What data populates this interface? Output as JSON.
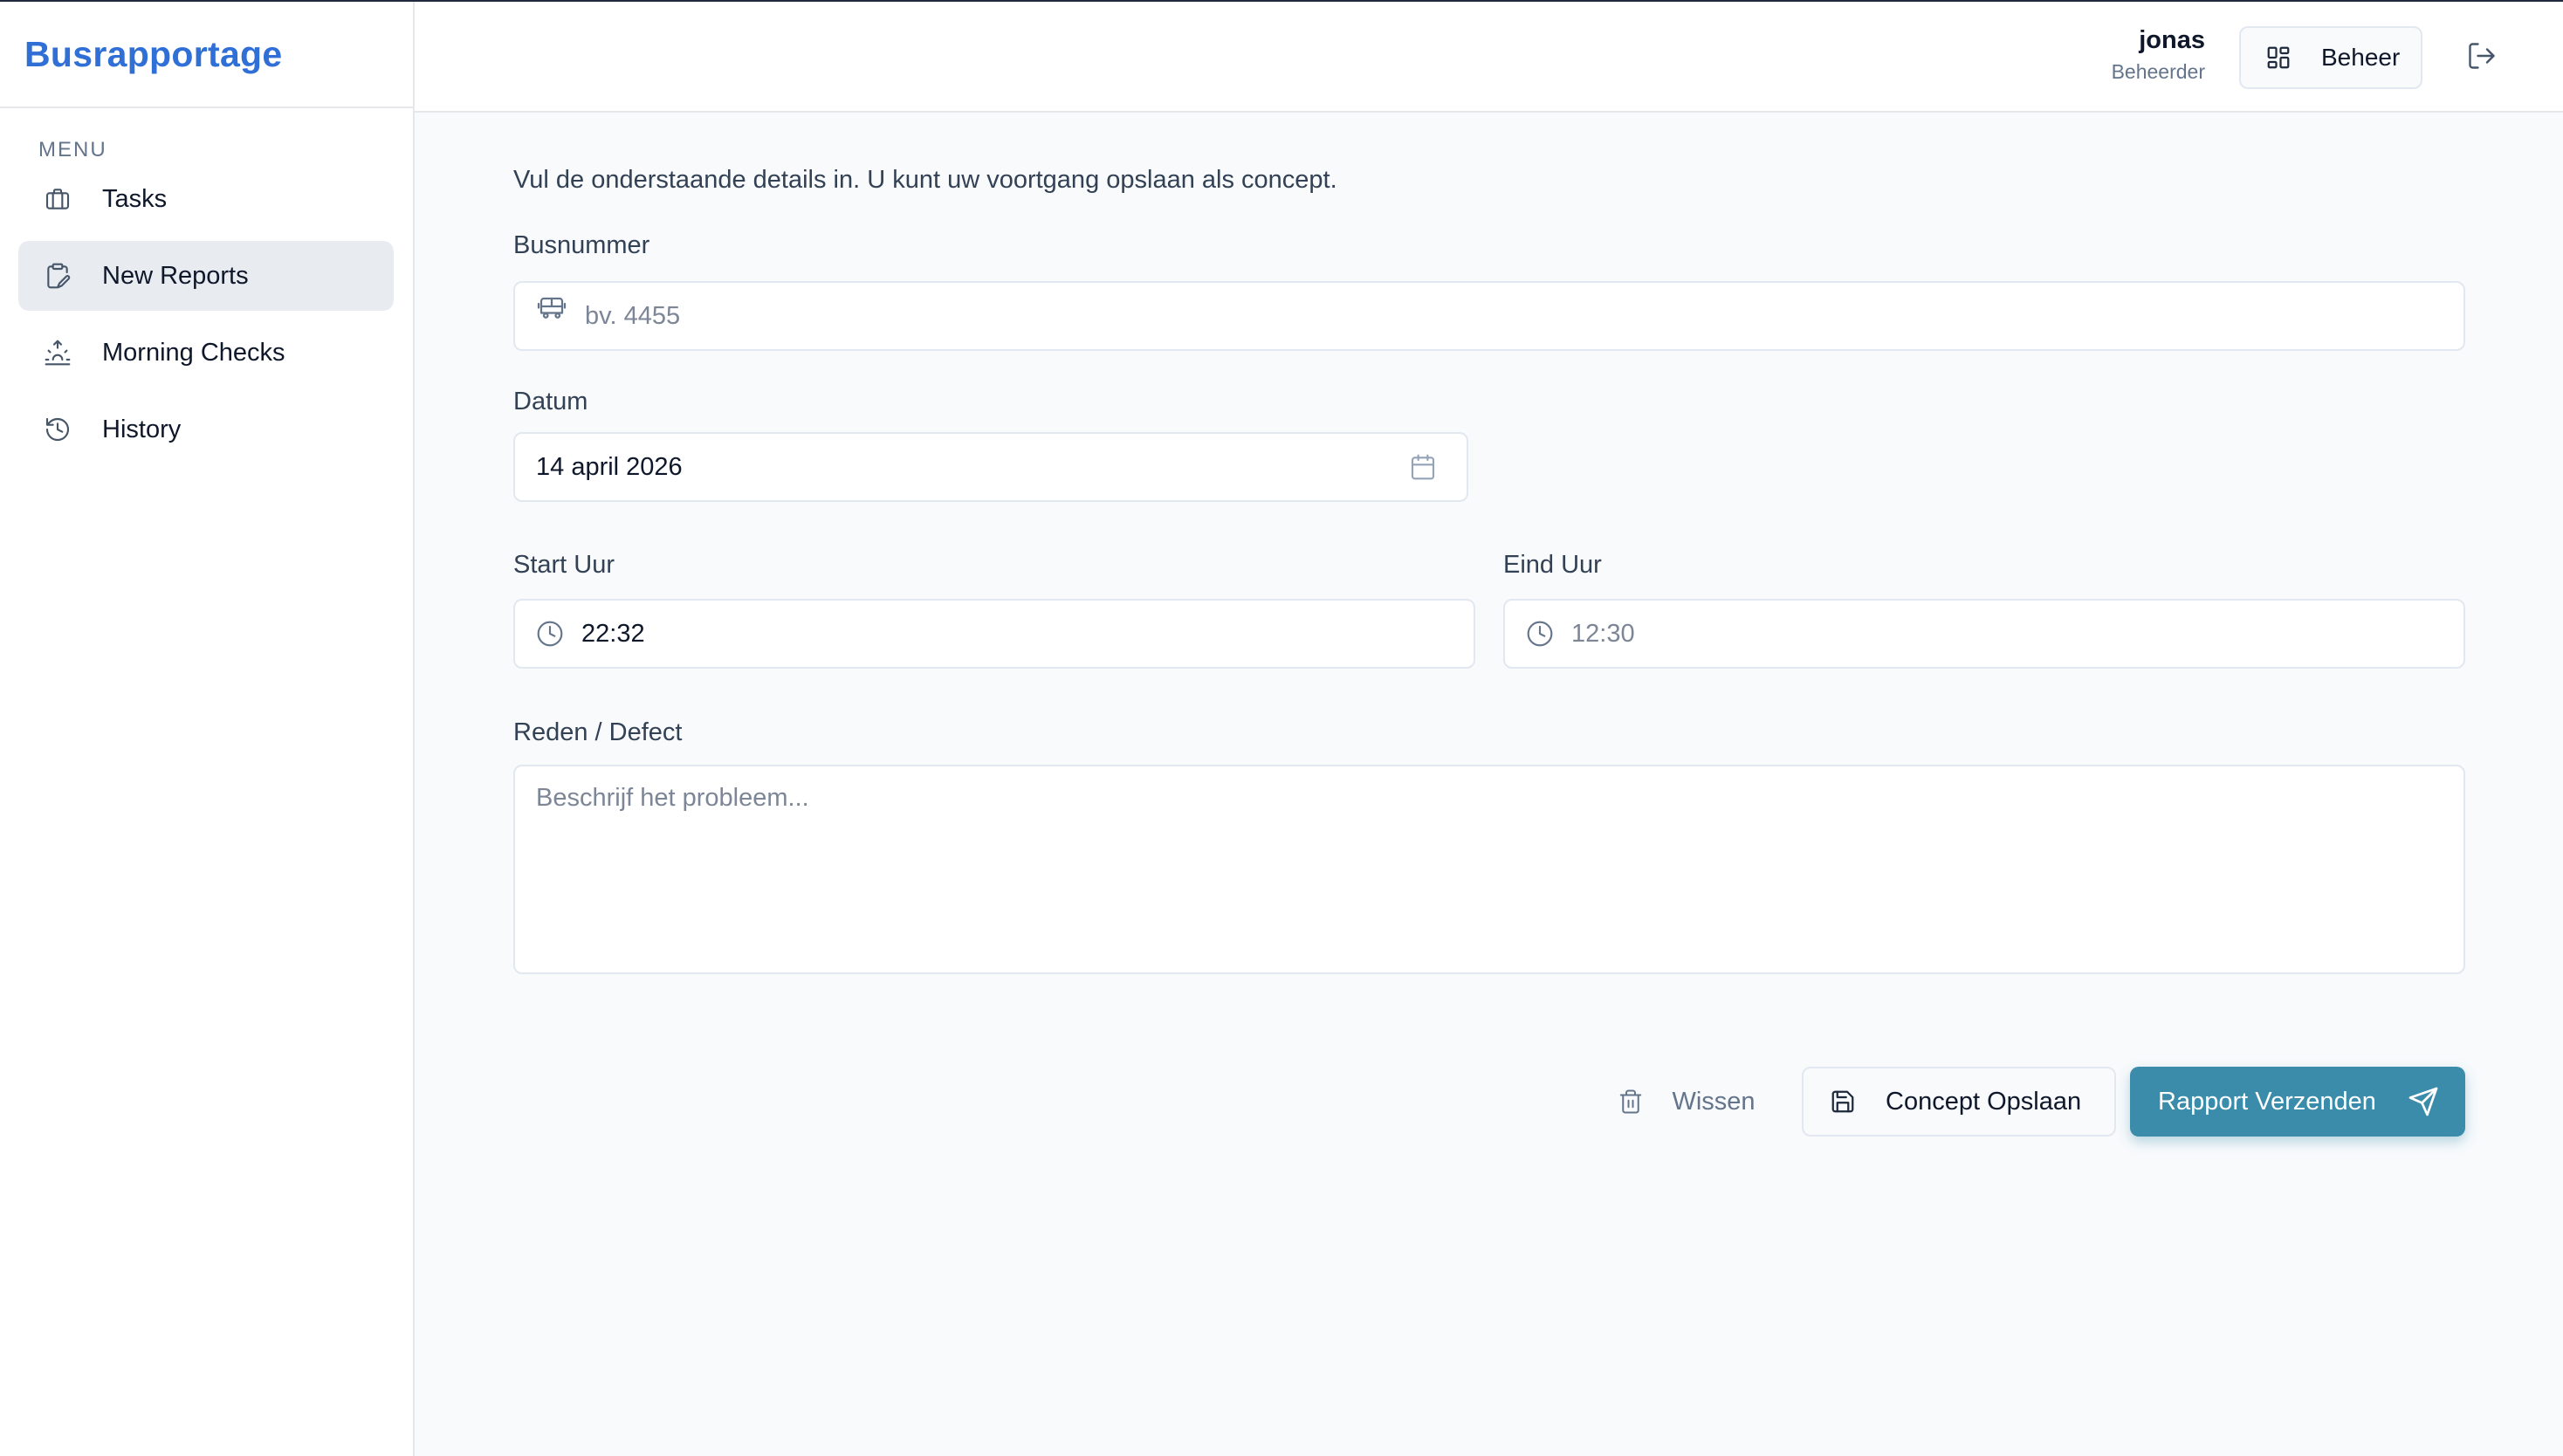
{
  "app": {
    "title": "Busrapportage"
  },
  "sidebar": {
    "menu_label": "MENU",
    "items": [
      {
        "label": "Tasks",
        "icon": "briefcase-icon",
        "active": false
      },
      {
        "label": "New Reports",
        "icon": "clipboard-edit-icon",
        "active": true
      },
      {
        "label": "Morning Checks",
        "icon": "sunrise-icon",
        "active": false
      },
      {
        "label": "History",
        "icon": "history-icon",
        "active": false
      }
    ]
  },
  "header": {
    "user_name": "jonas",
    "user_role": "Beheerder",
    "admin_button": "Beheer"
  },
  "form": {
    "intro": "Vul de onderstaande details in. U kunt uw voortgang opslaan als concept.",
    "busnummer": {
      "label": "Busnummer",
      "value": "",
      "placeholder": "bv. 4455"
    },
    "datum": {
      "label": "Datum",
      "value": "14 april 2026"
    },
    "start_uur": {
      "label": "Start Uur",
      "value": "22:32"
    },
    "eind_uur": {
      "label": "Eind Uur",
      "value": "",
      "placeholder": "12:30"
    },
    "reden": {
      "label": "Reden / Defect",
      "value": "",
      "placeholder": "Beschrijf het probleem..."
    }
  },
  "actions": {
    "clear": "Wissen",
    "save_draft": "Concept Opslaan",
    "submit": "Rapport Verzenden"
  },
  "colors": {
    "brand": "#2f6fd6",
    "primary_button": "#3b8bab",
    "active_nav": "#e8ecf1",
    "background": "#f8fafc"
  }
}
